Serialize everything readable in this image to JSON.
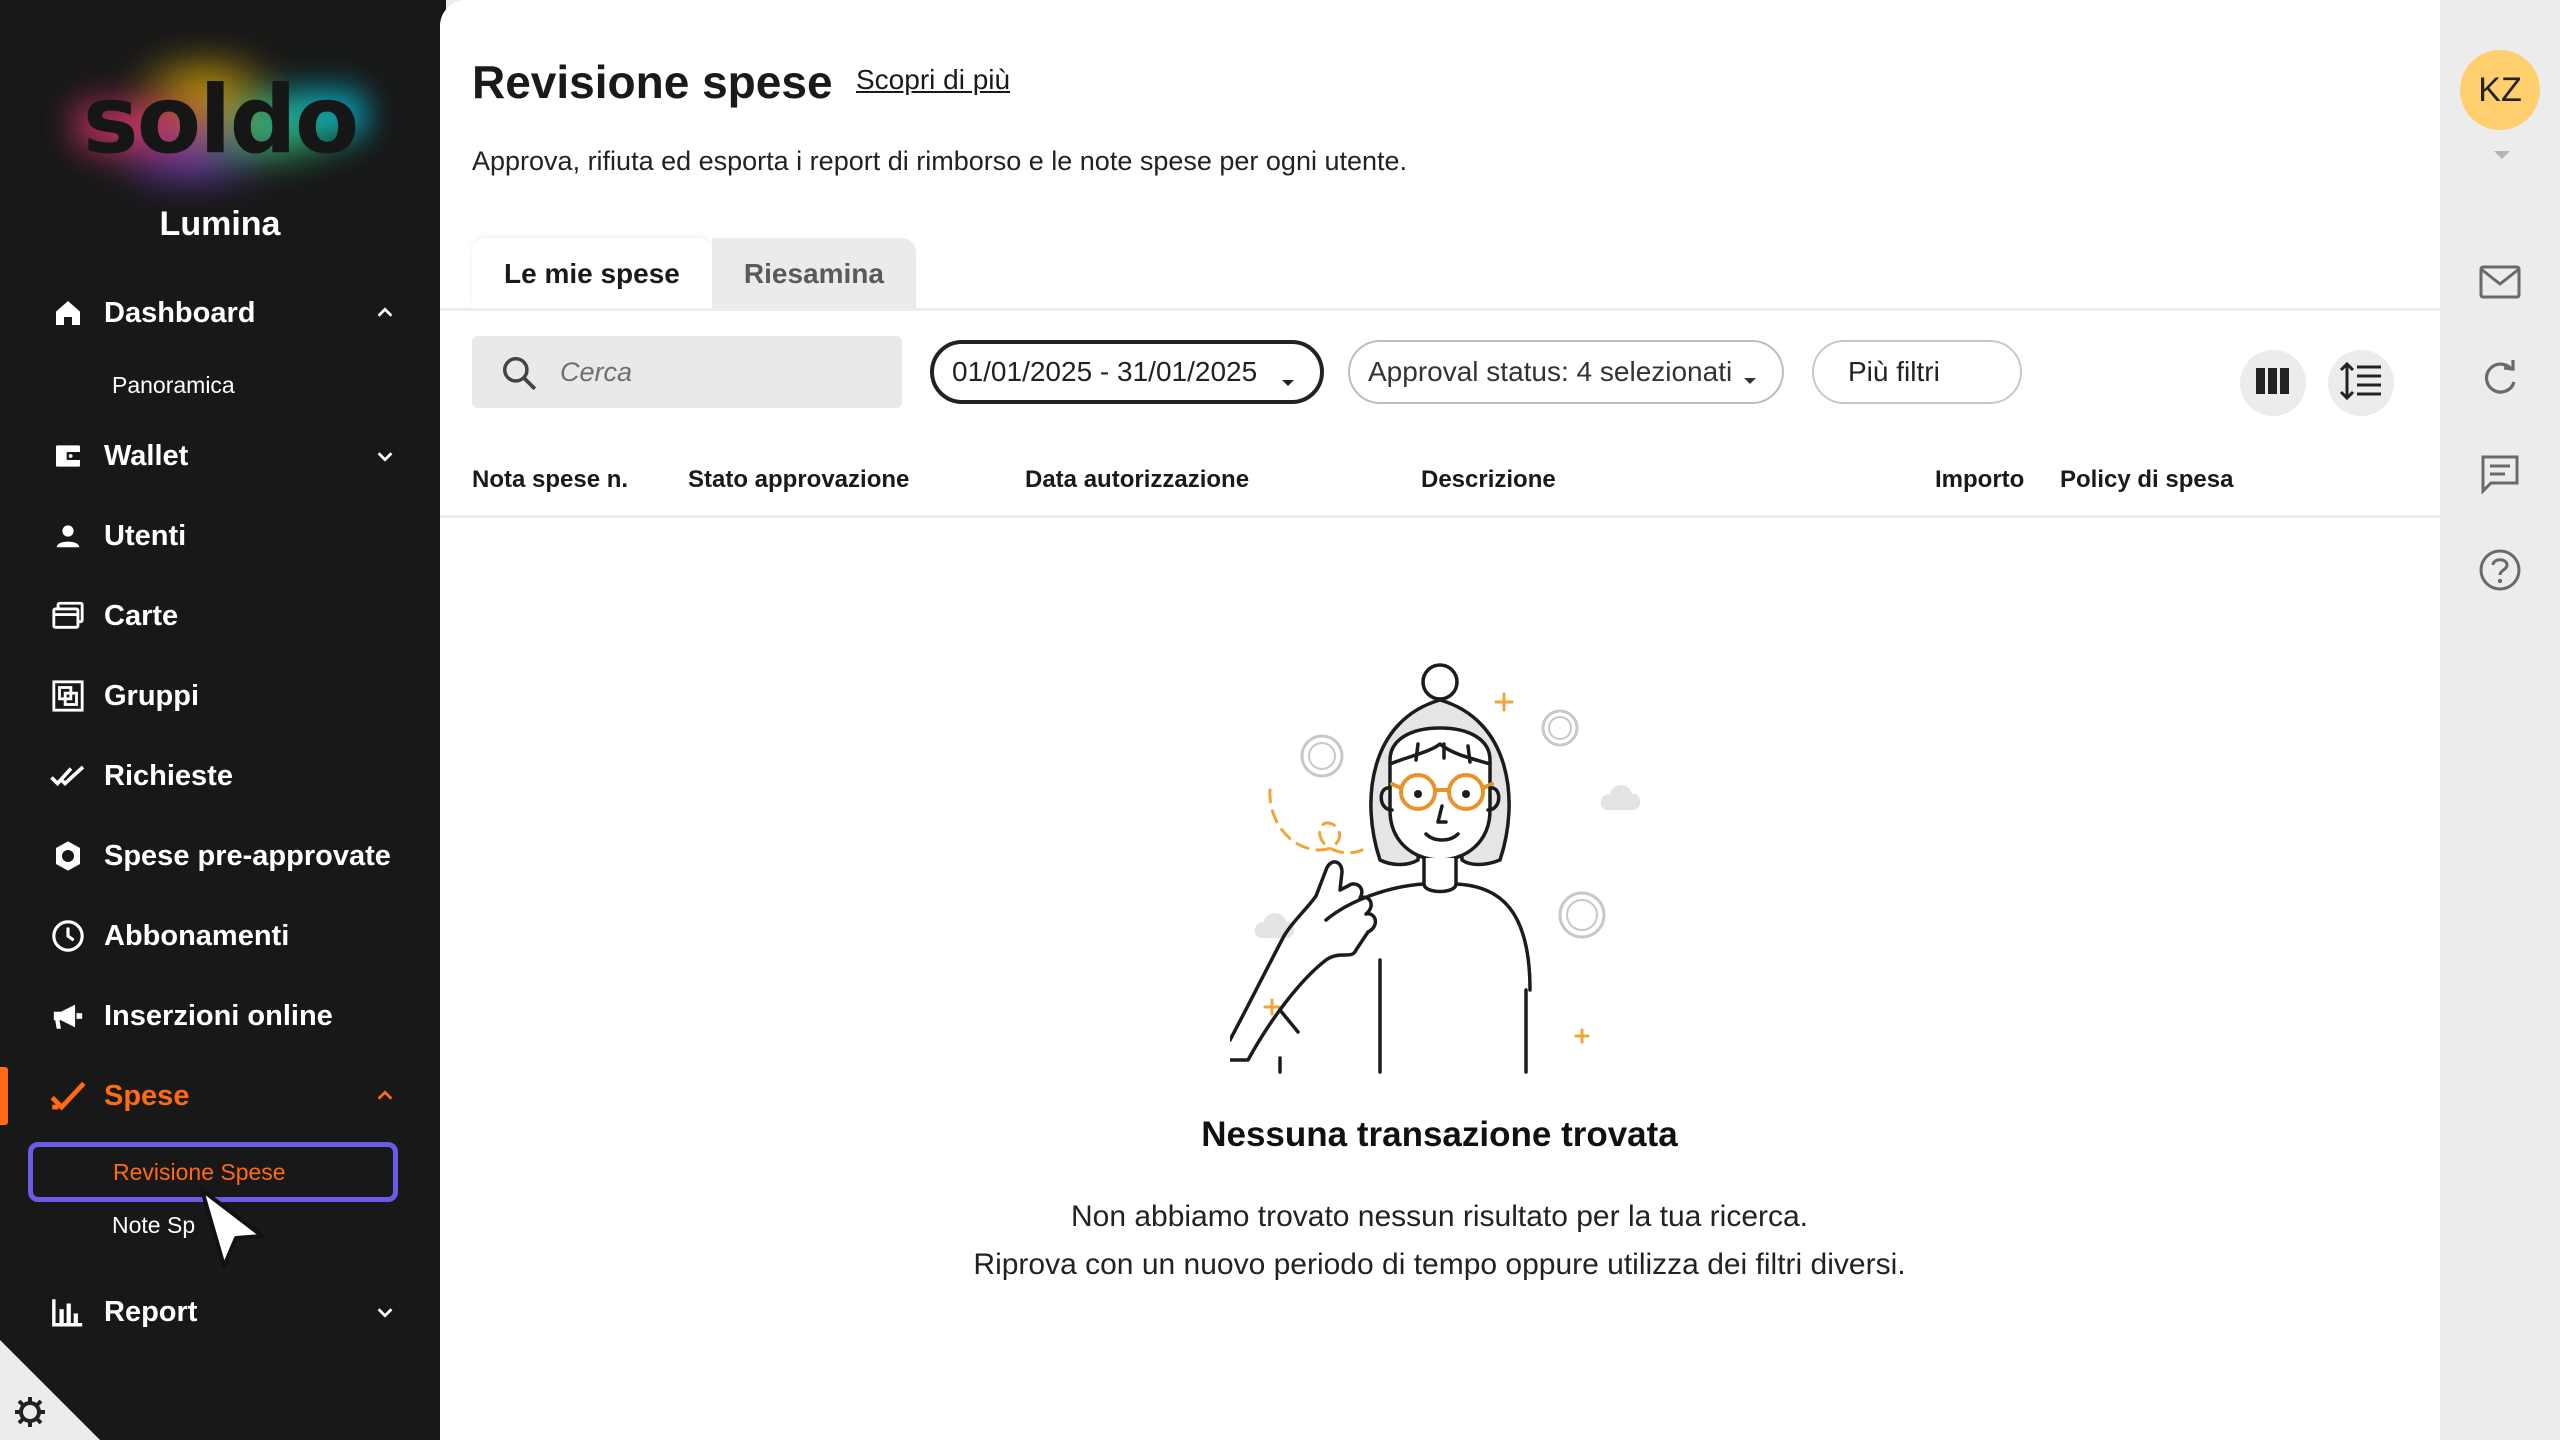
{
  "sidebar": {
    "logo_text": "soldo",
    "company": "Lumina",
    "nav": {
      "dashboard": "Dashboard",
      "panoramica": "Panoramica",
      "wallet": "Wallet",
      "utenti": "Utenti",
      "carte": "Carte",
      "gruppi": "Gruppi",
      "richieste": "Richieste",
      "spese_preapprovate": "Spese pre-approvate",
      "abbonamenti": "Abbonamenti",
      "inserzioni": "Inserzioni online",
      "spese": "Spese",
      "revisione_spese": "Revisione Spese",
      "note_spese": "Note Sp",
      "report": "Report"
    },
    "active_color": "#ff6a13",
    "highlight_color": "#6b5ce7"
  },
  "header": {
    "title": "Revisione spese",
    "learn_more": "Scopri di più",
    "subtitle": "Approva, rifiuta ed esporta i report di rimborso e le note spese per ogni utente."
  },
  "tabs": [
    {
      "label": "Le mie spese",
      "selected": true
    },
    {
      "label": "Riesamina",
      "selected": false
    }
  ],
  "filters": {
    "search_placeholder": "Cerca",
    "date_range": "01/01/2025 - 31/01/2025",
    "approval_status": "Approval status: 4 selezionati",
    "more_filters": "Più filtri"
  },
  "table": {
    "columns": [
      "Nota spese n.",
      "Stato approvazione",
      "Data autorizzazione",
      "Descrizione",
      "Importo",
      "Policy di spesa"
    ]
  },
  "empty_state": {
    "title": "Nessuna transazione trovata",
    "message_line1": "Non abbiamo trovato nessun risultato per la tua ricerca.",
    "message_line2": "Riprova con un nuovo periodo di tempo oppure utilizza dei filtri diversi."
  },
  "right_rail": {
    "avatar_initials": "KZ",
    "avatar_color": "#ffcf6e",
    "icons": [
      "mail-icon",
      "refresh-icon",
      "chat-icon",
      "help-icon"
    ]
  }
}
